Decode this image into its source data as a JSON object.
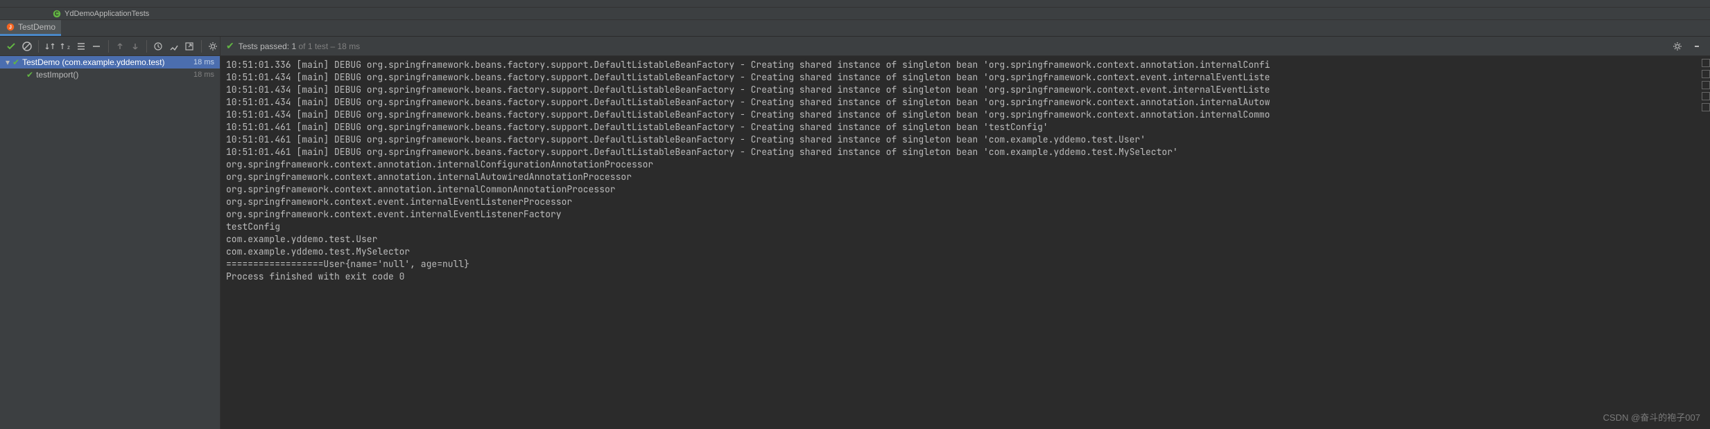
{
  "breadcrumb": {
    "label": "YdDemoApplicationTests"
  },
  "tab": {
    "label": "TestDemo"
  },
  "status": {
    "prefix": "Tests passed: ",
    "passed": "1",
    "suffix": " of 1 test – 18 ms"
  },
  "tree": [
    {
      "label": "TestDemo (com.example.yddemo.test)",
      "time": "18 ms",
      "selected": true,
      "indent": 0,
      "expandable": true
    },
    {
      "label": "testImport()",
      "time": "18 ms",
      "selected": false,
      "indent": 1,
      "expandable": false
    }
  ],
  "console": [
    "10:51:01.336 [main] DEBUG org.springframework.beans.factory.support.DefaultListableBeanFactory - Creating shared instance of singleton bean 'org.springframework.context.annotation.internalConfi",
    "10:51:01.434 [main] DEBUG org.springframework.beans.factory.support.DefaultListableBeanFactory - Creating shared instance of singleton bean 'org.springframework.context.event.internalEventListe",
    "10:51:01.434 [main] DEBUG org.springframework.beans.factory.support.DefaultListableBeanFactory - Creating shared instance of singleton bean 'org.springframework.context.event.internalEventListe",
    "10:51:01.434 [main] DEBUG org.springframework.beans.factory.support.DefaultListableBeanFactory - Creating shared instance of singleton bean 'org.springframework.context.annotation.internalAutow",
    "10:51:01.434 [main] DEBUG org.springframework.beans.factory.support.DefaultListableBeanFactory - Creating shared instance of singleton bean 'org.springframework.context.annotation.internalCommo",
    "10:51:01.461 [main] DEBUG org.springframework.beans.factory.support.DefaultListableBeanFactory - Creating shared instance of singleton bean 'testConfig'",
    "10:51:01.461 [main] DEBUG org.springframework.beans.factory.support.DefaultListableBeanFactory - Creating shared instance of singleton bean 'com.example.yddemo.test.User'",
    "10:51:01.461 [main] DEBUG org.springframework.beans.factory.support.DefaultListableBeanFactory - Creating shared instance of singleton bean 'com.example.yddemo.test.MySelector'",
    "org.springframework.context.annotation.internalConfigurationAnnotationProcessor",
    "org.springframework.context.annotation.internalAutowiredAnnotationProcessor",
    "org.springframework.context.annotation.internalCommonAnnotationProcessor",
    "org.springframework.context.event.internalEventListenerProcessor",
    "org.springframework.context.event.internalEventListenerFactory",
    "testConfig",
    "com.example.yddemo.test.User",
    "com.example.yddemo.test.MySelector",
    "==================User{name='null', age=null}",
    "",
    "Process finished with exit code 0"
  ],
  "watermark": "CSDN @奋斗的袍子007"
}
